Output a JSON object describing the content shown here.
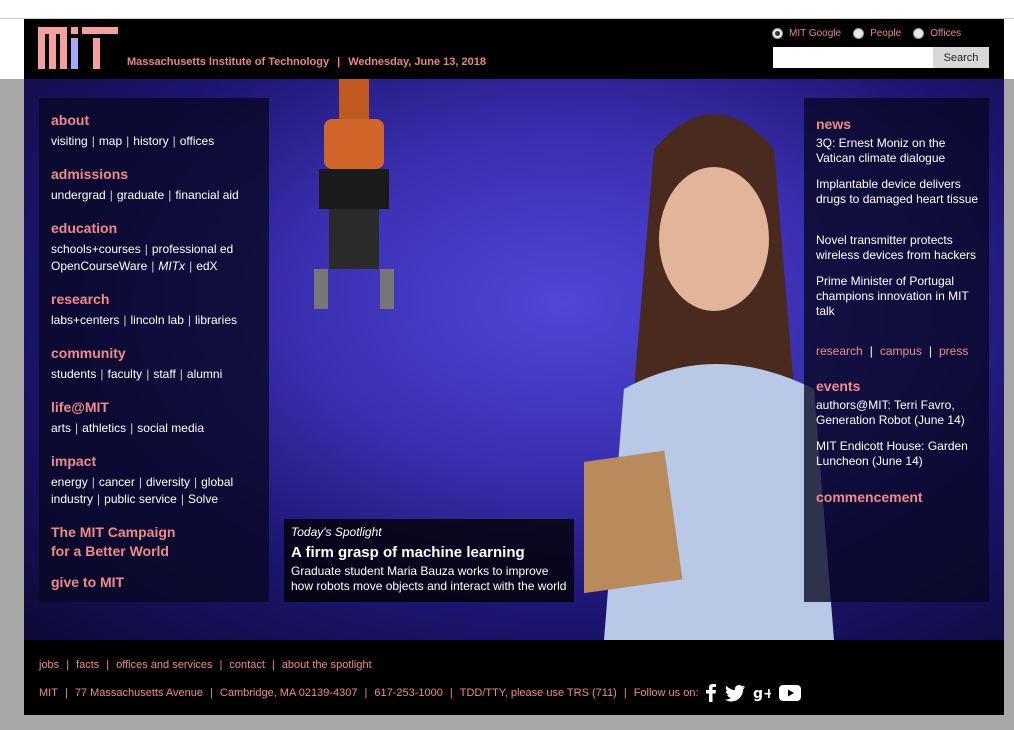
{
  "header": {
    "institute": "Massachusetts Institute of Technology",
    "separator": "|",
    "date": "Wednesday, June 13, 2018",
    "search_options": [
      "MIT Google",
      "People",
      "Offices"
    ],
    "search_selected": "MIT Google",
    "search_placeholder": "",
    "search_button": "Search"
  },
  "nav": {
    "about": {
      "label": "about",
      "links": [
        "visiting",
        "map",
        "history",
        "offices"
      ]
    },
    "admissions": {
      "label": "admissions",
      "links": [
        "undergrad",
        "graduate",
        "financial aid"
      ]
    },
    "education": {
      "label": "education",
      "links_row1": [
        "schools+courses",
        "professional ed"
      ],
      "links_row2": [
        "OpenCourseWare",
        "MITx",
        "edX"
      ]
    },
    "research": {
      "label": "research",
      "links": [
        "labs+centers",
        "lincoln lab",
        "libraries"
      ]
    },
    "community": {
      "label": "community",
      "links": [
        "students",
        "faculty",
        "staff",
        "alumni"
      ]
    },
    "life": {
      "label": "life@MIT",
      "links": [
        "arts",
        "athletics",
        "social media"
      ]
    },
    "impact": {
      "label": "impact",
      "links_row1": [
        "energy",
        "cancer",
        "diversity",
        "global"
      ],
      "links_row2": [
        "industry",
        "public service",
        "Solve"
      ]
    },
    "campaign_line1": "The MIT Campaign",
    "campaign_line2": "for a Better World",
    "give": "give to MIT"
  },
  "news": {
    "heading": "news",
    "items": [
      "3Q: Ernest Moniz on the Vatican climate dialogue",
      "Implantable device delivers drugs to damaged heart tissue",
      "Novel transmitter protects wireless devices from hackers",
      "Prime Minister of Portugal champions innovation in MIT talk"
    ],
    "links": [
      "research",
      "campus",
      "press"
    ]
  },
  "events": {
    "heading": "events",
    "items": [
      "authors@MIT: Terri Favro, Generation Robot (June 14)",
      "MIT Endicott House: Garden Luncheon (June 14)"
    ]
  },
  "commencement": "commencement",
  "spotlight": {
    "label": "Today's Spotlight",
    "title": "A firm grasp of machine learning",
    "description": "Graduate student Maria Bauza works to improve how robots move objects and interact with the world"
  },
  "footer": {
    "links": [
      "jobs",
      "facts",
      "offices and services",
      "contact",
      "about the spotlight"
    ],
    "mit": "MIT",
    "address": "77 Massachusetts Avenue",
    "city": "Cambridge, MA 02139-4307",
    "phone": "617-253-1000",
    "tty": "TDD/TTY, please use TRS (711)",
    "follow": "Follow us on:"
  },
  "colors": {
    "accent": "#f08a8a",
    "header_bg": "#000000",
    "hero_blue": "#3a2fb0"
  }
}
